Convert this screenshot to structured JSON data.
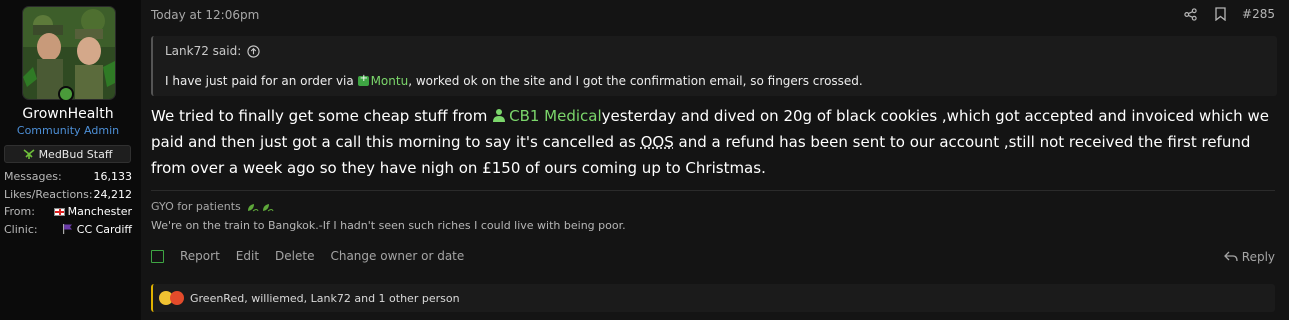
{
  "user": {
    "name": "GrownHealth",
    "title": "Community Admin",
    "badge": "MedBud Staff",
    "stats": [
      {
        "label": "Messages:",
        "value": "16,133"
      },
      {
        "label": "Likes/Reactions:",
        "value": "24,212"
      },
      {
        "label": "From:",
        "value": "Manchester",
        "icon": "england-flag-icon"
      },
      {
        "label": "Clinic:",
        "value": "CC Cardiff",
        "icon": "purple-flag-icon"
      }
    ]
  },
  "post": {
    "timestamp": "Today at 12:06pm",
    "number": "#285",
    "quote": {
      "author": "Lank72 said:",
      "before": "I have just paid for an order via ",
      "link": "Montu",
      "after": ", worked ok on the site and I got the confirmation email, so fingers crossed."
    },
    "message": {
      "part1": "We tried to finally get some cheap stuff from ",
      "link": "CB1 Medical",
      "part2": "yesterday and dived on 20g of black cookies ,which got accepted and invoiced which we paid and then just got a call this morning to say it's cancelled as ",
      "abbr": "OOS",
      "part3": " and a refund has been sent to our account ,still not received the first refund from over a week ago so they have nigh on £150 of ours coming up to Christmas."
    },
    "signature": {
      "title": "GYO for patients",
      "text": "We're on the train to Bangkok.-If I hadn't seen such riches I could live with being poor."
    },
    "actions": {
      "report": "Report",
      "edit": "Edit",
      "delete": "Delete",
      "change_owner": "Change owner or date",
      "reply": "Reply"
    },
    "reactions": "GreenRed, williemed, Lank72 and 1 other person"
  },
  "colors": {
    "accent_green": "#7bd66b",
    "title_blue": "#4d8fd6",
    "reaction_bar": "#e0b200"
  }
}
